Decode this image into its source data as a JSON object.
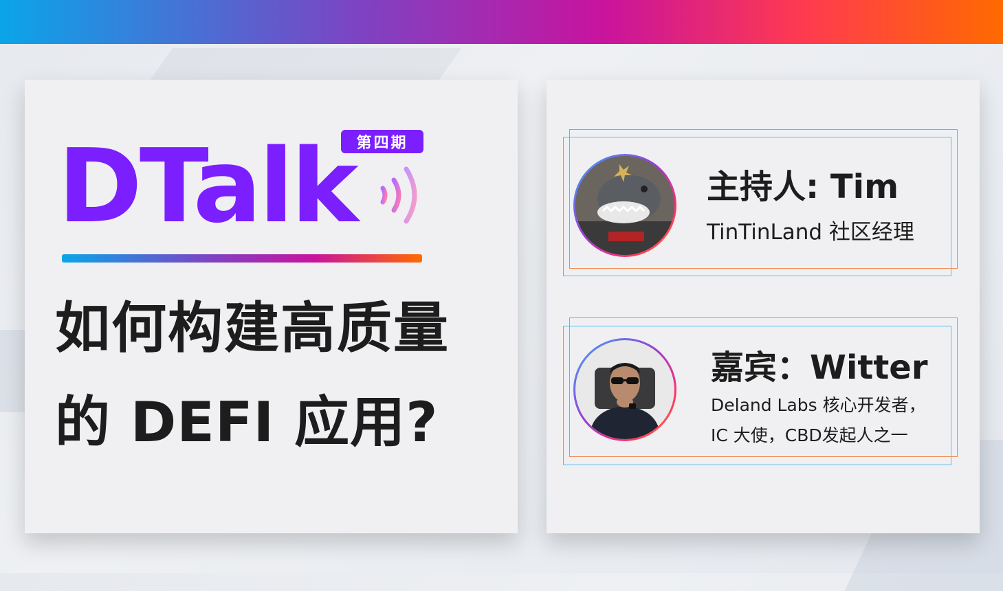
{
  "colors": {
    "brand_purple": "#7b1fff",
    "gradient_start": "#0aa5e8",
    "gradient_mid": "#c8139e",
    "gradient_end": "#ff6a00",
    "text_dark": "#1d1d1d",
    "panel_bg": "#f0f0f2"
  },
  "header": {
    "issue_badge": "第四期",
    "brand": "DTalk",
    "icon": "sound-waves-icon"
  },
  "headline": {
    "line1": "如何构建高质量",
    "line2": "的 DEFI 应用?"
  },
  "host": {
    "role": "主持人: Tim",
    "description": "TinTinLand 社区经理",
    "avatar": "shark-mascot-avatar"
  },
  "guest": {
    "role": "嘉宾：Witter",
    "description_line1": "Deland Labs 核心开发者，",
    "description_line2": "IC 大使，CBD发起人之一",
    "avatar": "man-with-sunglasses-avatar"
  }
}
